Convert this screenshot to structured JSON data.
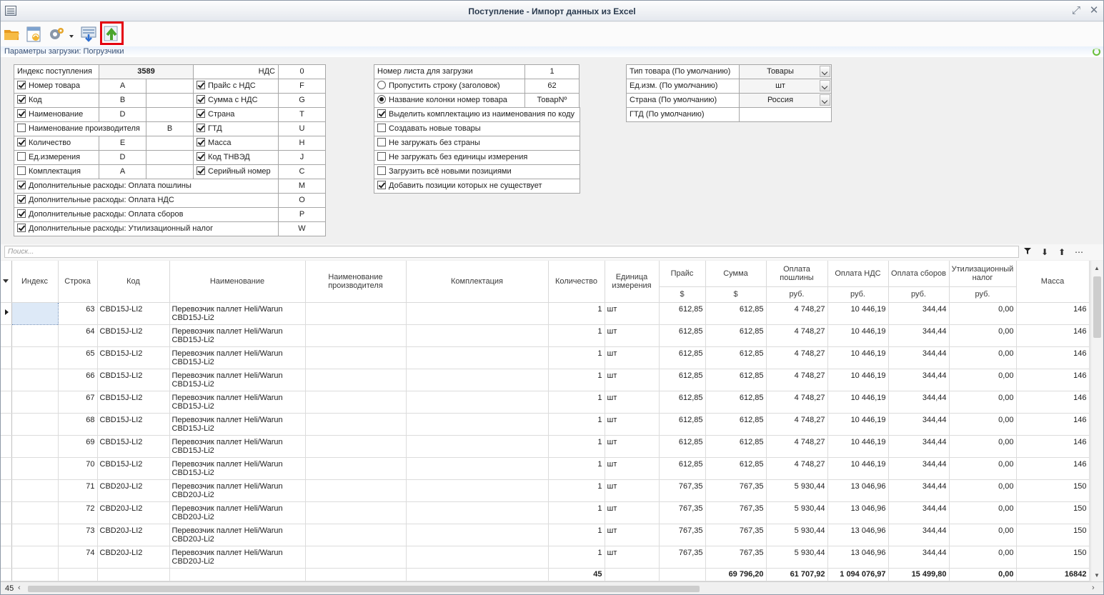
{
  "window": {
    "title": "Поступление - Импорт данных из Excel"
  },
  "icons": {
    "toolbar": [
      "open-folder-icon",
      "refresh-file-icon",
      "settings-gear-icon",
      "dropdown-arrow-icon",
      "save-db-icon",
      "upload-arrow-icon"
    ],
    "search_tools": [
      "filter-icon",
      "sort-down-icon",
      "sort-up-icon",
      "more-icon"
    ],
    "highlight_color": "#e4000f"
  },
  "params_label": "Параметры загрузки: Погрузчики",
  "left_block": {
    "index_label": "Индекс поступления",
    "index_value": "3589",
    "vat_label": "НДС",
    "vat_value": "0",
    "rows": [
      {
        "l_label": "Номер товара",
        "l_on": true,
        "l_val": "A",
        "r_label": "Прайс с НДС",
        "r_on": true,
        "r_val": "F"
      },
      {
        "l_label": "Код",
        "l_on": true,
        "l_val": "B",
        "r_label": "Сумма с НДС",
        "r_on": true,
        "r_val": "G"
      },
      {
        "l_label": "Наименование",
        "l_on": true,
        "l_val": "D",
        "r_label": "Страна",
        "r_on": true,
        "r_val": "T"
      },
      {
        "l_label": "Наименование производителя",
        "l_on": false,
        "l_val": "B",
        "r_label": "ГТД",
        "r_on": true,
        "r_val": "U"
      },
      {
        "l_label": "Количество",
        "l_on": true,
        "l_val": "E",
        "r_label": "Масса",
        "r_on": true,
        "r_val": "H"
      },
      {
        "l_label": "Ед.измерения",
        "l_on": false,
        "l_val": "D",
        "r_label": "Код ТНВЭД",
        "r_on": true,
        "r_val": "J"
      },
      {
        "l_label": "Комплектация",
        "l_on": false,
        "l_val": "A",
        "r_label": "Серийный номер",
        "r_on": true,
        "r_val": "C"
      }
    ],
    "extra": [
      {
        "label": "Дополнительные расходы: Оплата пошлины",
        "on": true,
        "val": "M"
      },
      {
        "label": "Дополнительные расходы: Оплата НДС",
        "on": true,
        "val": "O"
      },
      {
        "label": "Дополнительные расходы: Оплата сборов",
        "on": true,
        "val": "P"
      },
      {
        "label": "Дополнительные расходы: Утилизационный налог",
        "on": true,
        "val": "W"
      }
    ]
  },
  "mid_block": {
    "sheet_label": "Номер листа для загрузки",
    "sheet_value": "1",
    "skip_label": "Пропустить строку (заголовок)",
    "skip_value": "62",
    "colname_label": "Название колонки номер товара",
    "colname_value": "ТоварNº",
    "options": [
      {
        "label": "Выделить комплектацию из наименования по коду",
        "on": true
      },
      {
        "label": "Создавать новые товары",
        "on": false
      },
      {
        "label": "Не загружать без страны",
        "on": false
      },
      {
        "label": "Не загружать без единицы измерения",
        "on": false
      },
      {
        "label": "Загрузить всё новыми позициями",
        "on": false
      },
      {
        "label": "Добавить позиции которых не существует",
        "on": true
      }
    ]
  },
  "right_block": {
    "rows": [
      {
        "label": "Тип товара (По умолчанию)",
        "value": "Товары"
      },
      {
        "label": "Ед.изм. (По умолчанию)",
        "value": "шт"
      },
      {
        "label": "Страна (По умолчанию)",
        "value": "Россия"
      }
    ],
    "gtd_label": "ГТД (По умолчанию)",
    "gtd_value": ""
  },
  "search": {
    "placeholder": "Поиск..."
  },
  "table": {
    "headers": [
      "Индекс",
      "Строка",
      "Код",
      "Наименование",
      "Наименование производителя",
      "Комплектация",
      "Количество",
      "Единица измерения",
      "Прайс",
      "Сумма",
      "Оплата пошлины",
      "Оплата НДС",
      "Оплата сборов",
      "Утилизационный налог",
      "Масса"
    ],
    "units": [
      "$",
      "$",
      "руб.",
      "руб.",
      "руб.",
      "руб."
    ],
    "rows": [
      {
        "row": "63",
        "code": "CBD15J-LI2",
        "name1": "Перевозчик паллет Heli/Warun",
        "name2": "CBD15J-Li2",
        "qty": "1",
        "unit": "шт",
        "price": "612,85",
        "sum": "612,85",
        "duty": "4 748,27",
        "vat": "10 446,19",
        "fees": "344,44",
        "util": "0,00",
        "mass": "146"
      },
      {
        "row": "64",
        "code": "CBD15J-LI2",
        "name1": "Перевозчик паллет Heli/Warun",
        "name2": "CBD15J-Li2",
        "qty": "1",
        "unit": "шт",
        "price": "612,85",
        "sum": "612,85",
        "duty": "4 748,27",
        "vat": "10 446,19",
        "fees": "344,44",
        "util": "0,00",
        "mass": "146"
      },
      {
        "row": "65",
        "code": "CBD15J-LI2",
        "name1": "Перевозчик паллет Heli/Warun",
        "name2": "CBD15J-Li2",
        "qty": "1",
        "unit": "шт",
        "price": "612,85",
        "sum": "612,85",
        "duty": "4 748,27",
        "vat": "10 446,19",
        "fees": "344,44",
        "util": "0,00",
        "mass": "146"
      },
      {
        "row": "66",
        "code": "CBD15J-LI2",
        "name1": "Перевозчик паллет Heli/Warun",
        "name2": "CBD15J-Li2",
        "qty": "1",
        "unit": "шт",
        "price": "612,85",
        "sum": "612,85",
        "duty": "4 748,27",
        "vat": "10 446,19",
        "fees": "344,44",
        "util": "0,00",
        "mass": "146"
      },
      {
        "row": "67",
        "code": "CBD15J-LI2",
        "name1": "Перевозчик паллет Heli/Warun",
        "name2": "CBD15J-Li2",
        "qty": "1",
        "unit": "шт",
        "price": "612,85",
        "sum": "612,85",
        "duty": "4 748,27",
        "vat": "10 446,19",
        "fees": "344,44",
        "util": "0,00",
        "mass": "146"
      },
      {
        "row": "68",
        "code": "CBD15J-LI2",
        "name1": "Перевозчик паллет Heli/Warun",
        "name2": "CBD15J-Li2",
        "qty": "1",
        "unit": "шт",
        "price": "612,85",
        "sum": "612,85",
        "duty": "4 748,27",
        "vat": "10 446,19",
        "fees": "344,44",
        "util": "0,00",
        "mass": "146"
      },
      {
        "row": "69",
        "code": "CBD15J-LI2",
        "name1": "Перевозчик паллет Heli/Warun",
        "name2": "CBD15J-Li2",
        "qty": "1",
        "unit": "шт",
        "price": "612,85",
        "sum": "612,85",
        "duty": "4 748,27",
        "vat": "10 446,19",
        "fees": "344,44",
        "util": "0,00",
        "mass": "146"
      },
      {
        "row": "70",
        "code": "CBD15J-LI2",
        "name1": "Перевозчик паллет Heli/Warun",
        "name2": "CBD15J-Li2",
        "qty": "1",
        "unit": "шт",
        "price": "612,85",
        "sum": "612,85",
        "duty": "4 748,27",
        "vat": "10 446,19",
        "fees": "344,44",
        "util": "0,00",
        "mass": "146"
      },
      {
        "row": "71",
        "code": "CBD20J-LI2",
        "name1": "Перевозчик паллет Heli/Warun",
        "name2": "CBD20J-Li2",
        "qty": "1",
        "unit": "шт",
        "price": "767,35",
        "sum": "767,35",
        "duty": "5 930,44",
        "vat": "13 046,96",
        "fees": "344,44",
        "util": "0,00",
        "mass": "150"
      },
      {
        "row": "72",
        "code": "CBD20J-LI2",
        "name1": "Перевозчик паллет Heli/Warun",
        "name2": "CBD20J-Li2",
        "qty": "1",
        "unit": "шт",
        "price": "767,35",
        "sum": "767,35",
        "duty": "5 930,44",
        "vat": "13 046,96",
        "fees": "344,44",
        "util": "0,00",
        "mass": "150"
      },
      {
        "row": "73",
        "code": "CBD20J-LI2",
        "name1": "Перевозчик паллет Heli/Warun",
        "name2": "CBD20J-Li2",
        "qty": "1",
        "unit": "шт",
        "price": "767,35",
        "sum": "767,35",
        "duty": "5 930,44",
        "vat": "13 046,96",
        "fees": "344,44",
        "util": "0,00",
        "mass": "150"
      },
      {
        "row": "74",
        "code": "CBD20J-LI2",
        "name1": "Перевозчик паллет Heli/Warun",
        "name2": "CBD20J-Li2",
        "qty": "1",
        "unit": "шт",
        "price": "767,35",
        "sum": "767,35",
        "duty": "5 930,44",
        "vat": "13 046,96",
        "fees": "344,44",
        "util": "0,00",
        "mass": "150"
      }
    ],
    "totals": {
      "qty": "45",
      "sum": "69 796,20",
      "duty": "61 707,92",
      "vat": "1 094 076,97",
      "fees": "15 499,80",
      "util": "0,00",
      "mass": "16842"
    }
  },
  "status": {
    "count": "45"
  }
}
